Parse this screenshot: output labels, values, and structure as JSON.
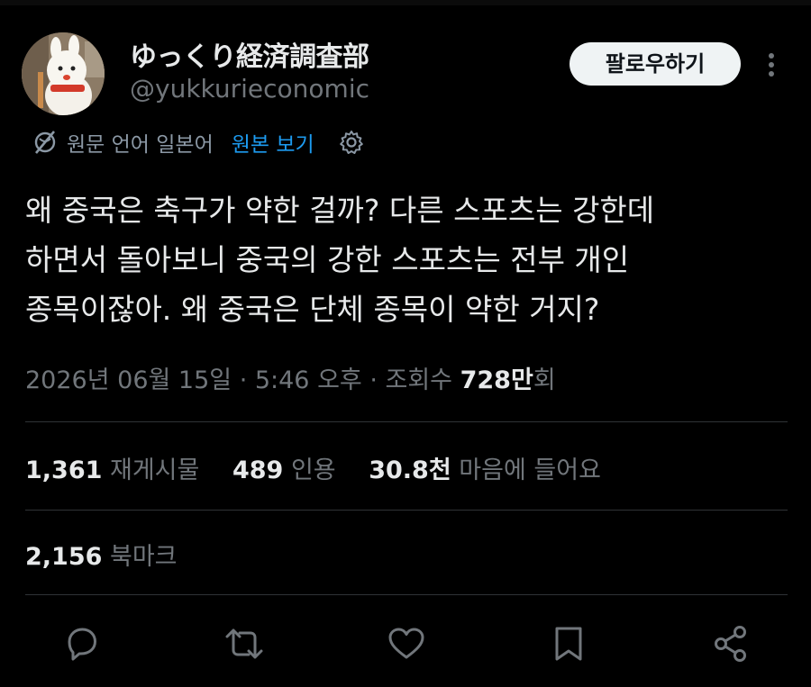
{
  "author": {
    "display_name": "ゆっくり経済調査部",
    "handle": "@yukkurieconomic"
  },
  "header": {
    "follow_label": "팔로우하기",
    "more_icon": "more-vertical-icon"
  },
  "translation": {
    "source_language_label": "원문 언어 일본어",
    "show_original_label": "원본 보기",
    "icon": "globe-translate-icon",
    "settings_icon": "gear-icon"
  },
  "tweet": {
    "lines": [
      "왜 중국은 축구가 약한 걸까? 다른 스포츠는 강한데",
      "하면서 돌아보니 중국의 강한 스포츠는 전부 개인",
      "종목이잖아. 왜 중국은 단체 종목이 약한 거지?"
    ]
  },
  "meta": {
    "timestamp": "2026년 06월 15일 · 5:46 오후 · 조회수 ",
    "views_count": "728만",
    "views_suffix": "회"
  },
  "stats": {
    "reposts_count": "1,361",
    "reposts_label": "재게시물",
    "quotes_count": "489",
    "quotes_label": "인용",
    "likes_count": "30.8천",
    "likes_label": "마음에 들어요",
    "bookmarks_count": "2,156",
    "bookmarks_label": "북마크"
  },
  "actions": [
    "reply-icon",
    "retweet-icon",
    "like-icon",
    "bookmark-icon",
    "share-icon"
  ],
  "colors": {
    "background": "#000000",
    "text_primary": "#e7e9ea",
    "text_secondary": "#71767b",
    "link": "#1d9bf0",
    "divider": "#2f3336",
    "follow_button_bg": "#eff3f4"
  }
}
